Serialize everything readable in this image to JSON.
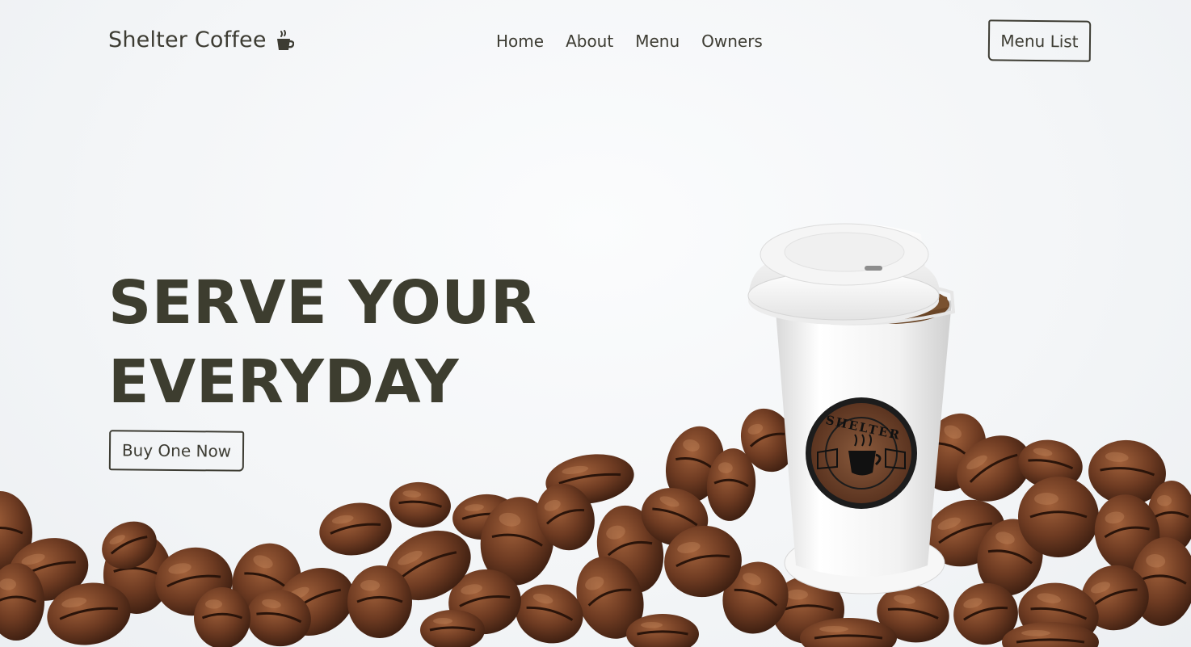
{
  "header": {
    "brand_name": "Shelter Coffee",
    "brand_icon": "coffee-cup-icon",
    "nav": [
      {
        "label": "Home"
      },
      {
        "label": "About"
      },
      {
        "label": "Menu"
      },
      {
        "label": "Owners"
      }
    ],
    "menu_list_label": "Menu List"
  },
  "hero": {
    "title_line1": "SERVE YOUR",
    "title_line2": "EVERYDAY",
    "cta_label": "Buy One Now"
  },
  "cup": {
    "logo_text": "SHELTER"
  },
  "colors": {
    "text": "#3d3c33",
    "background": "#f4f6f8",
    "bean": "#6b3a22"
  }
}
